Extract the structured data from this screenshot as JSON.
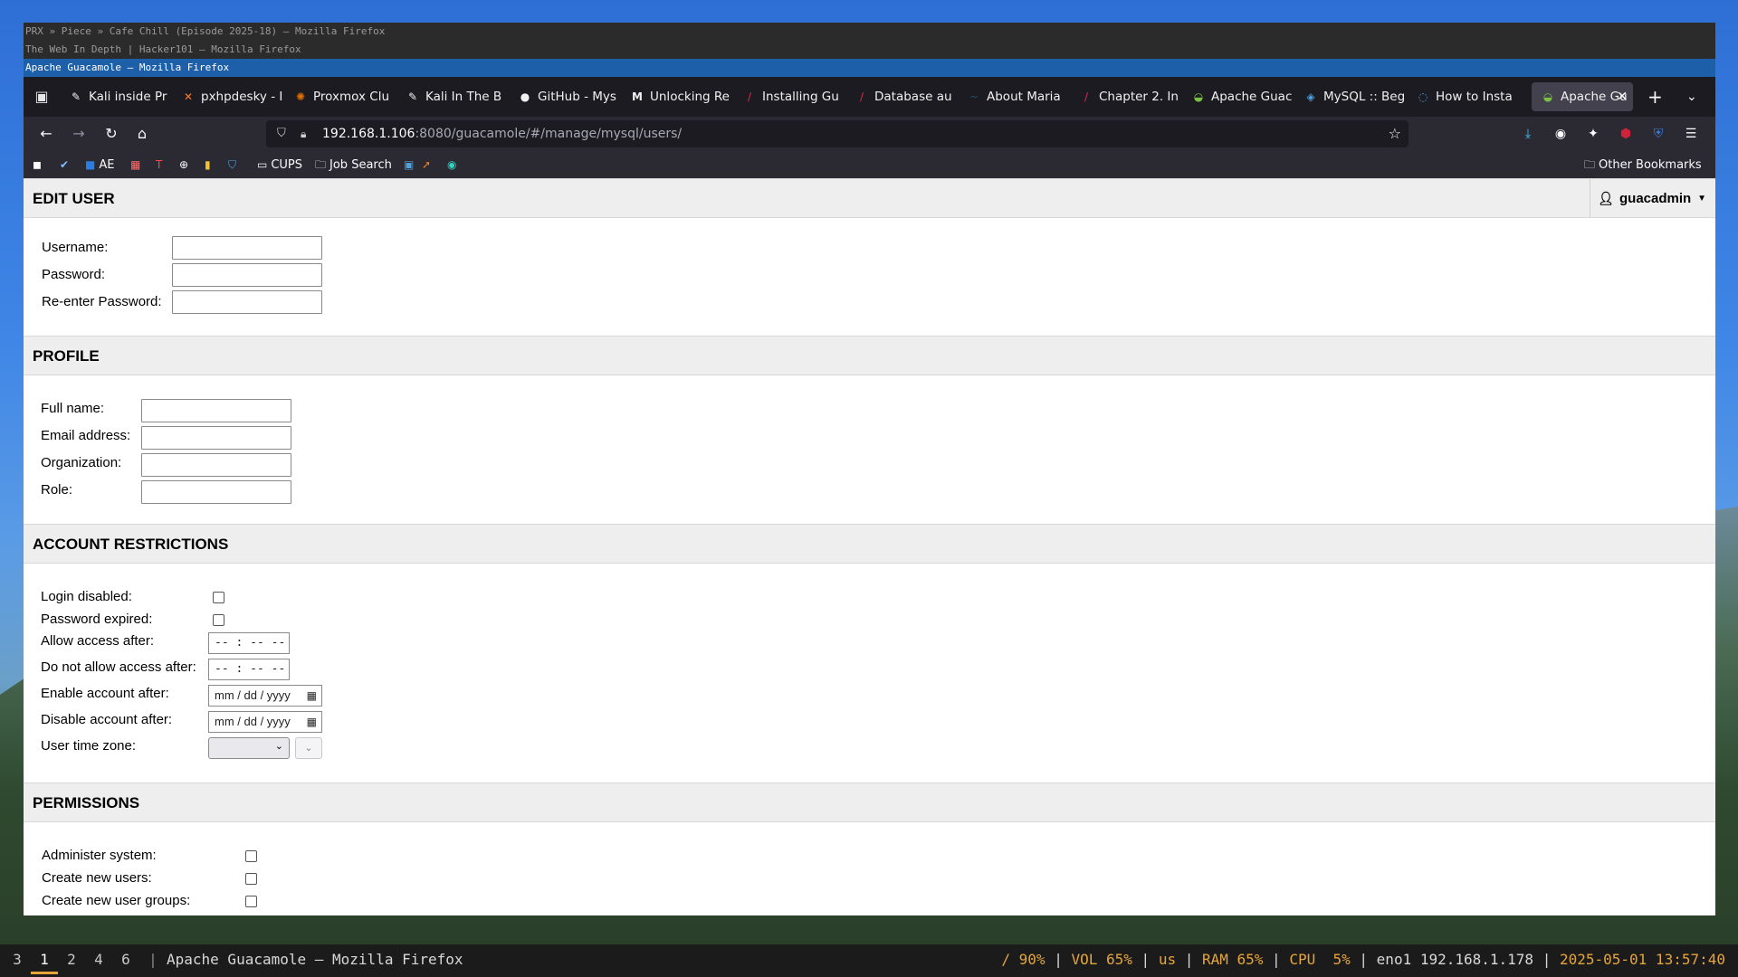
{
  "window_titles": [
    "PRX » Piece » Cafe Chill (Episode 2025-18) — Mozilla Firefox",
    "The Web In Depth | Hacker101 — Mozilla Firefox",
    "Apache Guacamole — Mozilla Firefox"
  ],
  "tabs": [
    {
      "label": "Kali inside Pr",
      "icon": "kali-icon"
    },
    {
      "label": "pxhpdesky - I",
      "icon": "x-icon"
    },
    {
      "label": "Proxmox Clu",
      "icon": "proxmox-icon"
    },
    {
      "label": "Kali In The B",
      "icon": "kali-icon"
    },
    {
      "label": "GitHub - Mys",
      "icon": "github-icon"
    },
    {
      "label": "Unlocking Re",
      "icon": "medium-icon"
    },
    {
      "label": "Installing Gu",
      "icon": "slash-icon"
    },
    {
      "label": "Database au",
      "icon": "slash-icon"
    },
    {
      "label": "About Maria",
      "icon": "mariadb-icon"
    },
    {
      "label": "Chapter 2. In",
      "icon": "slash-icon"
    },
    {
      "label": "Apache Guac",
      "icon": "guacamole-icon"
    },
    {
      "label": "MySQL :: Beg",
      "icon": "mysql-icon"
    },
    {
      "label": "How to Insta",
      "icon": "spinner-icon"
    },
    {
      "label": "Apache Gu",
      "icon": "guacamole-icon",
      "active": true
    }
  ],
  "nav": {
    "url_host": "192.168.1.106",
    "url_path": ":8080/guacamole/#/manage/mysql/users/"
  },
  "bookmarks": {
    "ae": "AE",
    "cups": "CUPS",
    "job_search": "Job Search",
    "other": "Other Bookmarks"
  },
  "edit_user": {
    "title": "EDIT USER",
    "username_label": "Username:",
    "password_label": "Password:",
    "reenter_label": "Re-enter Password:",
    "current_user": "guacadmin"
  },
  "profile": {
    "title": "PROFILE",
    "fullname_label": "Full name:",
    "email_label": "Email address:",
    "org_label": "Organization:",
    "role_label": "Role:"
  },
  "restrictions": {
    "title": "ACCOUNT RESTRICTIONS",
    "login_disabled_label": "Login disabled:",
    "password_expired_label": "Password expired:",
    "allow_after_label": "Allow access after:",
    "not_allow_after_label": "Do not allow access after:",
    "enable_after_label": "Enable account after:",
    "disable_after_label": "Disable account after:",
    "timezone_label": "User time zone:",
    "time_placeholder": "-- : --  --",
    "date_placeholder": "mm / dd / yyyy"
  },
  "permissions": {
    "title": "PERMISSIONS",
    "admin_label": "Administer system:",
    "create_users_label": "Create new users:",
    "create_groups_label": "Create new user groups:"
  },
  "statusbar": {
    "workspaces": [
      "3",
      "1",
      "2",
      "4",
      "6"
    ],
    "active_workspace": "1",
    "window_title": "Apache Guacamole — Mozilla Firefox",
    "disk": "/ 90%",
    "vol": "VOL 65%",
    "kbd": "us",
    "ram": "RAM 65%",
    "cpu": "CPU  5%",
    "net": "eno1 192.168.1.178",
    "datetime": "2025-05-01 13:57:40"
  },
  "colors": {
    "accent": "#e6a53a",
    "active_title_bar": "#1d5fa8",
    "tabbar": "#1c1b22",
    "navbar": "#2b2a33"
  }
}
